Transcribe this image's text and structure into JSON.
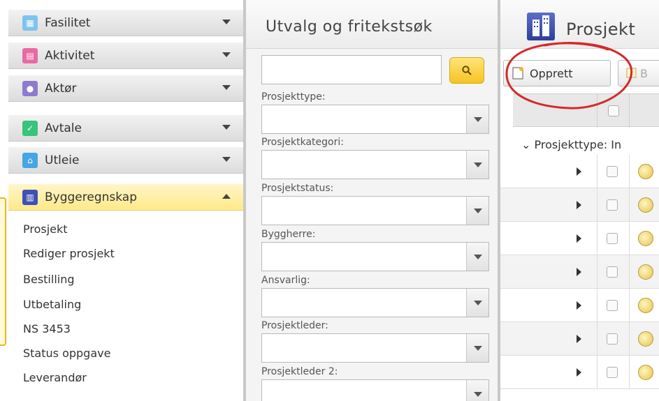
{
  "nav": {
    "items": [
      {
        "label": "Fasilitet",
        "icon": "grid-icon",
        "color": "#7fc4ee"
      },
      {
        "label": "Aktivitet",
        "icon": "calendar-icon",
        "color": "#e96aa3"
      },
      {
        "label": "Aktør",
        "icon": "people-icon",
        "color": "#8d7bd1"
      },
      {
        "label": "Avtale",
        "icon": "handshake-icon",
        "color": "#39c37b"
      },
      {
        "label": "Utleie",
        "icon": "house-icon",
        "color": "#45a6e3"
      },
      {
        "label": "Byggeregnskap",
        "icon": "building-icon",
        "color": "#3f51b5"
      }
    ],
    "sub_items": [
      "Prosjekt",
      "Rediger prosjekt",
      "Bestilling",
      "Utbetaling",
      "NS 3453",
      "Status oppgave",
      "Leverandør"
    ]
  },
  "filter": {
    "title": "Utvalg og fritekstsøk",
    "search_value": "",
    "fields": [
      "Prosjekttype:",
      "Prosjektkategori:",
      "Prosjektstatus:",
      "Byggherre:",
      "Ansvarlig:",
      "Prosjektleder:",
      "Prosjektleder 2:"
    ]
  },
  "project": {
    "title": "Prosjekt",
    "create_label": "Opprett",
    "edit_label": "B",
    "group_label": "Prosjekttype: In",
    "row_count": 7
  },
  "colors": {
    "accent_yellow": "#f6c423",
    "highlight_red": "#d42a2a"
  }
}
